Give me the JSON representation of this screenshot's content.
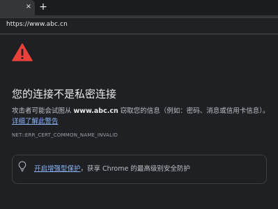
{
  "browser": {
    "tab_close": "×",
    "new_tab": "+",
    "url": "https://www.abc.cn"
  },
  "interstitial": {
    "icon": "warning-triangle-icon",
    "title": "您的连接不是私密连接",
    "desc_prefix": "攻击者可能会试图从 ",
    "desc_host": "www.abc.cn",
    "desc_middle": " 窃取您的信息（例如：密码、消息或信用卡信息）。",
    "desc_link": "详细了解此警告",
    "error_code": "NET::ERR_CERT_COMMON_NAME_INVALID",
    "promo_icon": "lightbulb-icon",
    "promo_link": "开启增强型保护",
    "promo_rest": "，获享 Chrome 的最高级别安全防护"
  },
  "colors": {
    "background": "#1f2023",
    "warning": "#e8423b",
    "link": "#8ab4f8",
    "text": "#e8eaed"
  }
}
